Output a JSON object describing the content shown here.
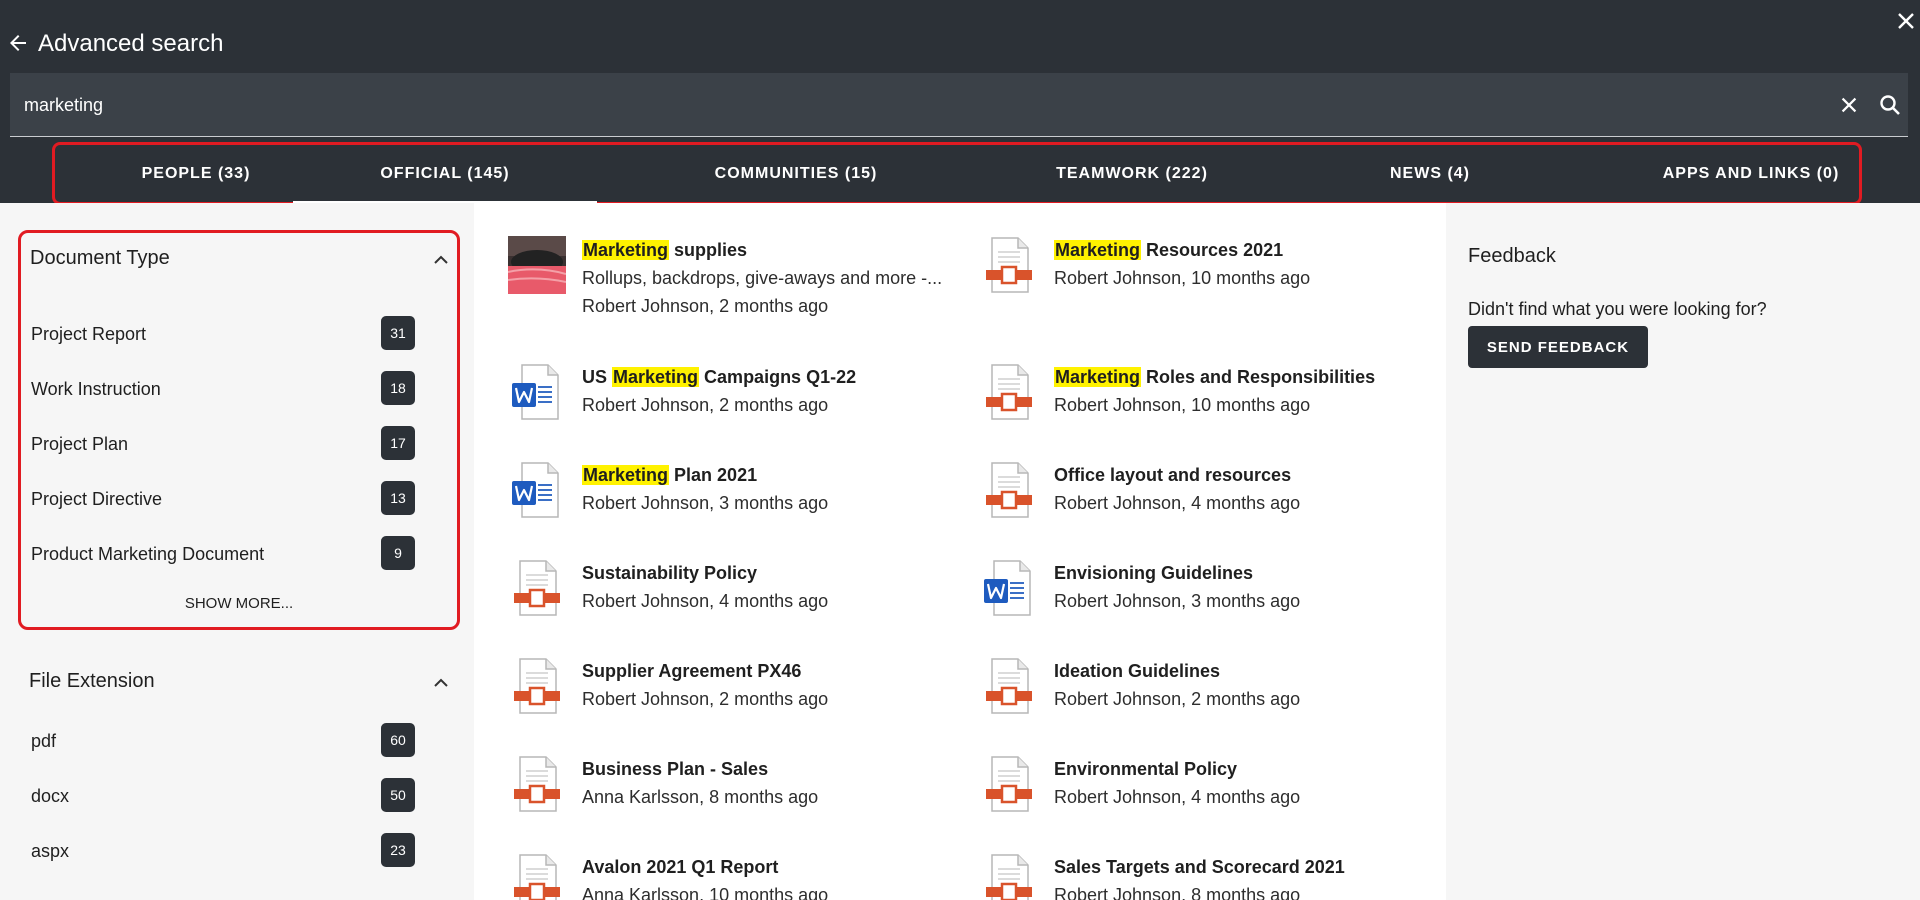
{
  "header": {
    "title": "Advanced search",
    "icons": [
      "back-arrow-icon",
      "close-icon"
    ]
  },
  "search": {
    "value": "marketing",
    "icons": [
      "clear-icon",
      "search-icon"
    ]
  },
  "tabs": [
    {
      "label": "PEOPLE (33)",
      "active": false
    },
    {
      "label": "OFFICIAL (145)",
      "active": true
    },
    {
      "label": "COMMUNITIES (15)",
      "active": false
    },
    {
      "label": "TEAMWORK (222)",
      "active": false
    },
    {
      "label": "NEWS (4)",
      "active": false
    },
    {
      "label": "APPS AND LINKS (0)",
      "active": false
    }
  ],
  "filters": {
    "document_type": {
      "title": "Document Type",
      "items": [
        {
          "label": "Project Report",
          "count": "31"
        },
        {
          "label": "Work Instruction",
          "count": "18"
        },
        {
          "label": "Project Plan",
          "count": "17"
        },
        {
          "label": "Project Directive",
          "count": "13"
        },
        {
          "label": "Product Marketing Document",
          "count": "9"
        }
      ],
      "show_more": "SHOW MORE..."
    },
    "file_extension": {
      "title": "File Extension",
      "items": [
        {
          "label": "pdf",
          "count": "60"
        },
        {
          "label": "docx",
          "count": "50"
        },
        {
          "label": "aspx",
          "count": "23"
        }
      ]
    }
  },
  "results": [
    {
      "icon": "image-thumbnail-icon",
      "title_highlight": "Marketing",
      "title_rest": " supplies",
      "snippet": "Rollups, backdrops, give-aways and more -...",
      "meta": "Robert Johnson, 2 months ago"
    },
    {
      "icon": "pdf-document-icon",
      "title_highlight": "Marketing",
      "title_rest": " Resources 2021",
      "meta": "Robert Johnson, 10 months ago"
    },
    {
      "icon": "word-document-icon",
      "title_prefix": "US ",
      "title_highlight": "Marketing",
      "title_rest": " Campaigns Q1-22",
      "meta": "Robert Johnson, 2 months ago"
    },
    {
      "icon": "pdf-document-icon",
      "title_highlight": "Marketing",
      "title_rest": " Roles and Responsibilities",
      "meta": "Robert Johnson, 10 months ago"
    },
    {
      "icon": "word-document-icon",
      "title_highlight": "Marketing",
      "title_rest": " Plan 2021",
      "meta": "Robert Johnson, 3 months ago"
    },
    {
      "icon": "pdf-document-icon",
      "title": "Office layout and resources",
      "meta": "Robert Johnson, 4 months ago"
    },
    {
      "icon": "pdf-document-icon",
      "title": "Sustainability Policy",
      "meta": "Robert Johnson, 4 months ago"
    },
    {
      "icon": "word-document-icon",
      "title": "Envisioning Guidelines",
      "meta": "Robert Johnson, 3 months ago"
    },
    {
      "icon": "pdf-document-icon",
      "title": "Supplier Agreement PX46",
      "meta": "Robert Johnson, 2 months ago"
    },
    {
      "icon": "pdf-document-icon",
      "title": "Ideation Guidelines",
      "meta": "Robert Johnson, 2 months ago"
    },
    {
      "icon": "pdf-document-icon",
      "title": "Business Plan - Sales",
      "meta": "Anna Karlsson, 8 months ago"
    },
    {
      "icon": "pdf-document-icon",
      "title": "Environmental Policy",
      "meta": "Robert Johnson, 4 months ago"
    },
    {
      "icon": "pdf-document-icon",
      "title": "Avalon 2021 Q1 Report",
      "meta": "Anna Karlsson, 10 months ago"
    },
    {
      "icon": "pdf-document-icon",
      "title": "Sales Targets and Scorecard 2021",
      "meta": "Robert Johnson, 8 months ago"
    }
  ],
  "feedback": {
    "title": "Feedback",
    "text": "Didn't find what you were looking for?",
    "button": "SEND FEEDBACK"
  },
  "colors": {
    "header_bg": "#2c3137",
    "search_bg": "#3b4148",
    "highlight": "#fff200",
    "annotation_red": "#e11b22",
    "side_panel_bg": "#f6f6f6",
    "badge_bg": "#2c3137",
    "pdf_icon_red": "#d9532b",
    "word_icon_blue": "#1e5bbf"
  }
}
